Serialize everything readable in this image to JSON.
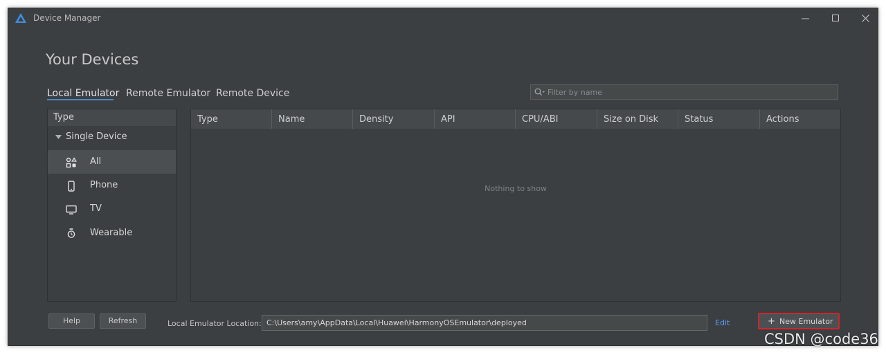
{
  "window": {
    "title": "Device Manager",
    "logo_icon": "harmony-logo-icon"
  },
  "heading": "Your Devices",
  "tabs": [
    {
      "label": "Local Emulator",
      "active": true
    },
    {
      "label": "Remote Emulator",
      "active": false
    },
    {
      "label": "Remote Device",
      "active": false
    }
  ],
  "filter": {
    "placeholder": "Filter by name",
    "icon": "search-icon"
  },
  "sidebar": {
    "header": "Type",
    "group": "Single Device",
    "items": [
      {
        "label": "All",
        "icon": "all-devices-icon",
        "selected": true
      },
      {
        "label": "Phone",
        "icon": "phone-icon",
        "selected": false
      },
      {
        "label": "TV",
        "icon": "tv-icon",
        "selected": false
      },
      {
        "label": "Wearable",
        "icon": "watch-icon",
        "selected": false
      }
    ]
  },
  "table": {
    "columns": [
      "Type",
      "Name",
      "Density",
      "API",
      "CPU/ABI",
      "Size on Disk",
      "Status",
      "Actions"
    ],
    "empty_text": "Nothing to show"
  },
  "footer": {
    "help_label": "Help",
    "refresh_label": "Refresh",
    "location_label": "Local Emulator Location:",
    "location_value": "C:\\Users\\amy\\AppData\\Local\\Huawei\\HarmonyOSEmulator\\deployed",
    "edit_label": "Edit",
    "new_emulator_label": "New Emulator",
    "new_emulator_plus": "+"
  },
  "watermark": "CSDN @code36",
  "colors": {
    "accent": "#4a88c7",
    "link": "#589df6",
    "highlight": "#d0262c",
    "background": "#3c3f41"
  }
}
